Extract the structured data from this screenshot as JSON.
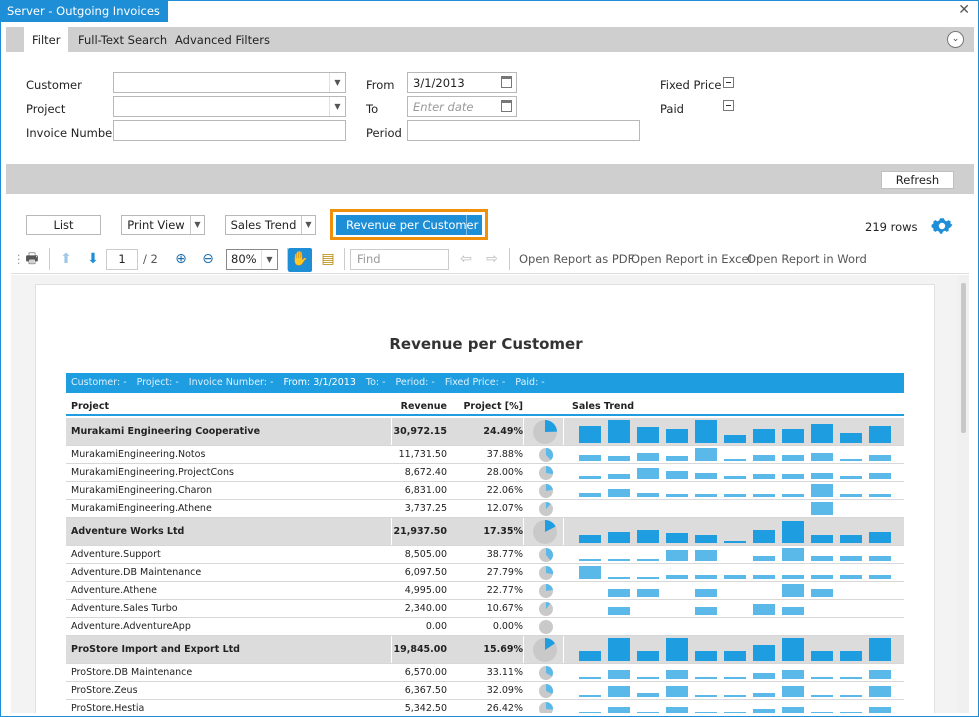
{
  "window": {
    "title": "Server - Outgoing Invoices",
    "close": "✕"
  },
  "tabs": [
    {
      "label": "Filter"
    },
    {
      "label": "Full-Text Search"
    },
    {
      "label": "Advanced Filters"
    }
  ],
  "filter": {
    "customer_label": "Customer",
    "customer_value": "",
    "project_label": "Project",
    "project_value": "",
    "invoice_label": "Invoice Number",
    "invoice_value": "",
    "from_label": "From",
    "from_value": "3/1/2013",
    "to_label": "To",
    "to_placeholder": "Enter date",
    "period_label": "Period",
    "period_value": "",
    "fixed_price_label": "Fixed Price",
    "paid_label": "Paid"
  },
  "refresh_label": "Refresh",
  "views": {
    "list": "List",
    "print_view": "Print View",
    "sales_trend": "Sales Trend",
    "revenue": "Revenue per Customer",
    "row_count": "219 rows"
  },
  "toolbar": {
    "page": "1",
    "page_total": "/ 2",
    "zoom": "80%",
    "find_placeholder": "Find",
    "open_pdf": "Open Report as PDF",
    "open_excel": "Open Report in Excel",
    "open_word": "Open Report in Word"
  },
  "report": {
    "title": "Revenue per Customer",
    "filters": [
      {
        "text": "Customer: -",
        "hl": false
      },
      {
        "text": "Project: -",
        "hl": false
      },
      {
        "text": "Invoice Number: -",
        "hl": false
      },
      {
        "text": "From: 3/1/2013",
        "hl": true
      },
      {
        "text": "To: -",
        "hl": false
      },
      {
        "text": "Period: -",
        "hl": false
      },
      {
        "text": "Fixed Price: -",
        "hl": false
      },
      {
        "text": "Paid: -",
        "hl": false
      }
    ],
    "headers": {
      "project": "Project",
      "revenue": "Revenue",
      "pct": "Project [%]",
      "trend": "Sales Trend"
    },
    "rows": [
      {
        "type": "grp",
        "name": "Murakami Engineering Cooperative",
        "revenue": "30,972.15",
        "pct": "24.49%",
        "share": 0.2449,
        "trend": [
          0.7,
          0.95,
          0.65,
          0.6,
          0.95,
          0.35,
          0.6,
          0.6,
          0.8,
          0.4,
          0.7
        ]
      },
      {
        "type": "det",
        "name": "MurakamiEngineering.Notos",
        "revenue": "11,731.50",
        "pct": "37.88%",
        "share": 0.3788,
        "trend": [
          0.45,
          0.35,
          0.55,
          0.35,
          0.9,
          0.15,
          0.45,
          0.45,
          0.55,
          0.1,
          0.45
        ]
      },
      {
        "type": "det",
        "name": "MurakamiEngineering.ProjectCons",
        "revenue": "8,672.40",
        "pct": "28.00%",
        "share": 0.28,
        "trend": [
          0.2,
          0.35,
          0.75,
          0.55,
          0.45,
          0.2,
          0.35,
          0.35,
          0.45,
          0.2,
          0.45
        ]
      },
      {
        "type": "det",
        "name": "MurakamiEngineering.Charon",
        "revenue": "6,831.00",
        "pct": "22.06%",
        "share": 0.2206,
        "trend": [
          0.3,
          0.55,
          0.25,
          0.2,
          0.2,
          0.2,
          0.2,
          0.2,
          0.9,
          0.2,
          0.2
        ]
      },
      {
        "type": "det",
        "name": "MurakamiEngineering.Athene",
        "revenue": "3,737.25",
        "pct": "12.07%",
        "share": 0.1207,
        "trend": [
          0,
          0,
          0,
          0,
          0,
          0,
          0,
          0,
          0.9,
          0,
          0
        ]
      },
      {
        "type": "grp",
        "name": "Adventure Works Ltd",
        "revenue": "21,937.50",
        "pct": "17.35%",
        "share": 0.1735,
        "trend": [
          0.35,
          0.45,
          0.55,
          0.4,
          0.35,
          0.1,
          0.55,
          0.9,
          0.35,
          0.35,
          0.45
        ]
      },
      {
        "type": "det",
        "name": "Adventure.Support",
        "revenue": "8,505.00",
        "pct": "38.77%",
        "share": 0.3877,
        "trend": [
          0.1,
          0.1,
          0.1,
          0.75,
          0.75,
          0,
          0.35,
          0.9,
          0.35,
          0.35,
          0.35
        ]
      },
      {
        "type": "det",
        "name": "Adventure.DB Maintenance",
        "revenue": "6,097.50",
        "pct": "27.79%",
        "share": 0.2779,
        "trend": [
          0.9,
          0.1,
          0.1,
          0.3,
          0.3,
          0.3,
          0.3,
          0.3,
          0.3,
          0.3,
          0.3
        ]
      },
      {
        "type": "det",
        "name": "Adventure.Athene",
        "revenue": "4,995.00",
        "pct": "22.77%",
        "share": 0.2277,
        "trend": [
          0,
          0.55,
          0.55,
          0,
          0.55,
          0,
          0,
          0.9,
          0.55,
          0,
          0
        ]
      },
      {
        "type": "det",
        "name": "Adventure.Sales Turbo",
        "revenue": "2,340.00",
        "pct": "10.67%",
        "share": 0.1067,
        "trend": [
          0,
          0.55,
          0,
          0,
          0.55,
          0,
          0.75,
          0.55,
          0,
          0,
          0
        ]
      },
      {
        "type": "det",
        "name": "Adventure.AdventureApp",
        "revenue": "0.00",
        "pct": "0.00%",
        "share": 0,
        "trend": [
          0,
          0,
          0,
          0,
          0,
          0,
          0,
          0,
          0,
          0,
          0
        ]
      },
      {
        "type": "grp",
        "name": "ProStore Import and Export Ltd",
        "revenue": "19,845.00",
        "pct": "15.69%",
        "share": 0.1569,
        "trend": [
          0.4,
          0.95,
          0.4,
          0.95,
          0.4,
          0.4,
          0.65,
          0.95,
          0.4,
          0.4,
          0.95
        ]
      },
      {
        "type": "det",
        "name": "ProStore.DB Maintenance",
        "revenue": "6,570.00",
        "pct": "33.11%",
        "share": 0.3311,
        "trend": [
          0.15,
          0.65,
          0.15,
          0.65,
          0.15,
          0.15,
          0.45,
          0.65,
          0.15,
          0.15,
          0.65
        ]
      },
      {
        "type": "det",
        "name": "ProStore.Zeus",
        "revenue": "6,367.50",
        "pct": "32.09%",
        "share": 0.3209,
        "trend": [
          0.15,
          0.8,
          0.3,
          0.8,
          0.15,
          0.15,
          0.3,
          0.8,
          0.15,
          0.15,
          0.8
        ]
      },
      {
        "type": "det",
        "name": "ProStore.Hestia",
        "revenue": "5,342.50",
        "pct": "26.42%",
        "share": 0.2642,
        "trend": [
          0.2,
          0.6,
          0.2,
          0.6,
          0.2,
          0.2,
          0.4,
          0.6,
          0.2,
          0.2,
          0.6
        ]
      }
    ]
  }
}
